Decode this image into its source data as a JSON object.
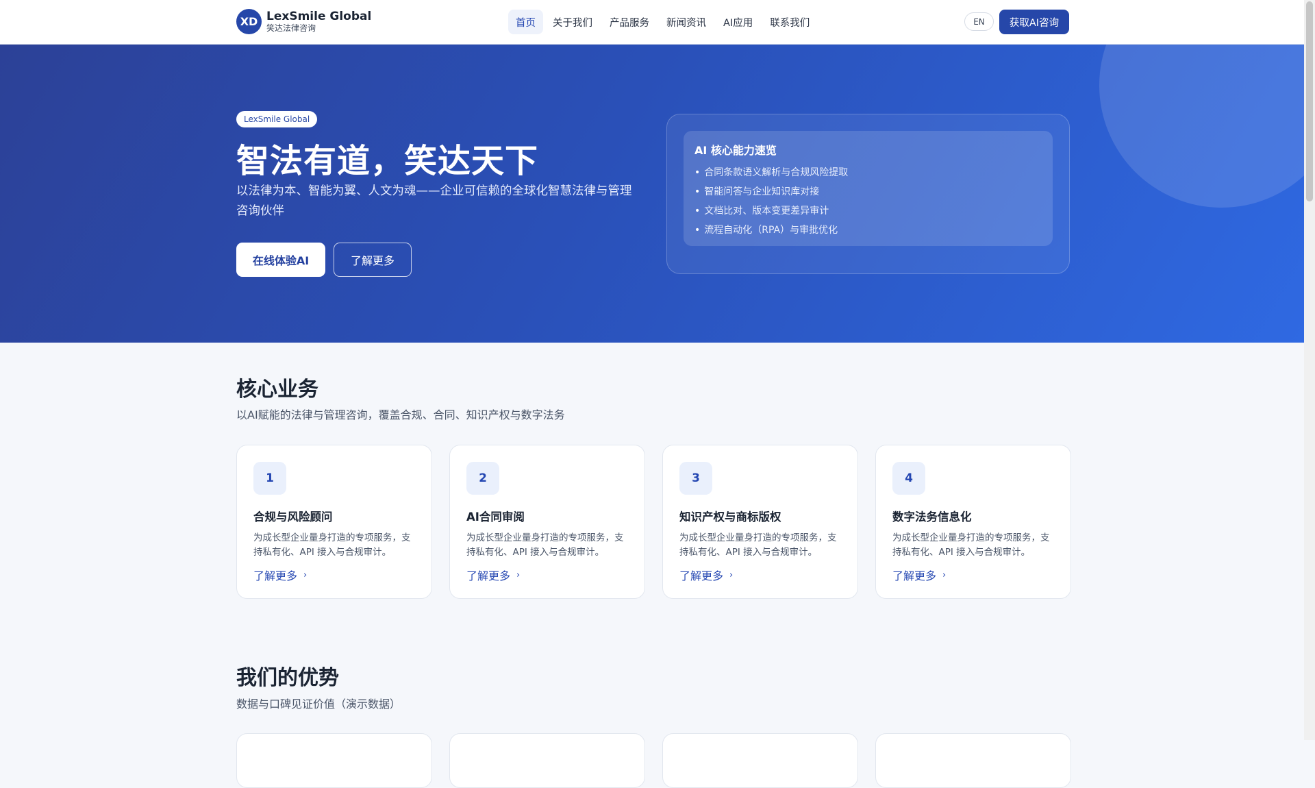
{
  "header": {
    "logo_mark": "XD",
    "logo_name": "LexSmile Global",
    "logo_sub": "笑达法律咨询",
    "nav": [
      {
        "label": "首页",
        "active": true
      },
      {
        "label": "关于我们",
        "active": false
      },
      {
        "label": "产品服务",
        "active": false
      },
      {
        "label": "新闻资讯",
        "active": false
      },
      {
        "label": "AI应用",
        "active": false
      },
      {
        "label": "联系我们",
        "active": false
      }
    ],
    "lang": "EN",
    "cta": "获取AI咨询"
  },
  "hero": {
    "badge": "LexSmile Global",
    "title": "智法有道，笑达天下",
    "subtitle": "以法律为本、智能为翼、人文为魂——企业可信赖的全球化智慧法律与管理咨询伙伴",
    "primary_button": "在线体验AI",
    "secondary_button": "了解更多",
    "ai_card": {
      "title": "AI 核心能力速览",
      "bullet": "•",
      "items": [
        "合同条款语义解析与合规风险提取",
        "智能问答与企业知识库对接",
        "文档比对、版本变更差异审计",
        "流程自动化（RPA）与审批优化"
      ]
    }
  },
  "core": {
    "title": "核心业务",
    "subtitle": "以AI赋能的法律与管理咨询，覆盖合规、合同、知识产权与数字法务",
    "link_chevron": "›",
    "cards": [
      {
        "num": "1",
        "title": "合规与风险顾问",
        "desc": "为成长型企业量身打造的专项服务，支持私有化、API 接入与合规审计。",
        "link": "了解更多"
      },
      {
        "num": "2",
        "title": "AI合同审阅",
        "desc": "为成长型企业量身打造的专项服务，支持私有化、API 接入与合规审计。",
        "link": "了解更多"
      },
      {
        "num": "3",
        "title": "知识产权与商标版权",
        "desc": "为成长型企业量身打造的专项服务，支持私有化、API 接入与合规审计。",
        "link": "了解更多"
      },
      {
        "num": "4",
        "title": "数字法务信息化",
        "desc": "为成长型企业量身打造的专项服务，支持私有化、API 接入与合规审计。",
        "link": "了解更多"
      }
    ]
  },
  "advantages": {
    "title": "我们的优势",
    "subtitle": "数据与口碑见证价值（演示数据）"
  },
  "colors": {
    "brand": "#2647a9",
    "hero_start": "#2c4197",
    "hero_end": "#2f69e2",
    "link": "#2547b2"
  }
}
